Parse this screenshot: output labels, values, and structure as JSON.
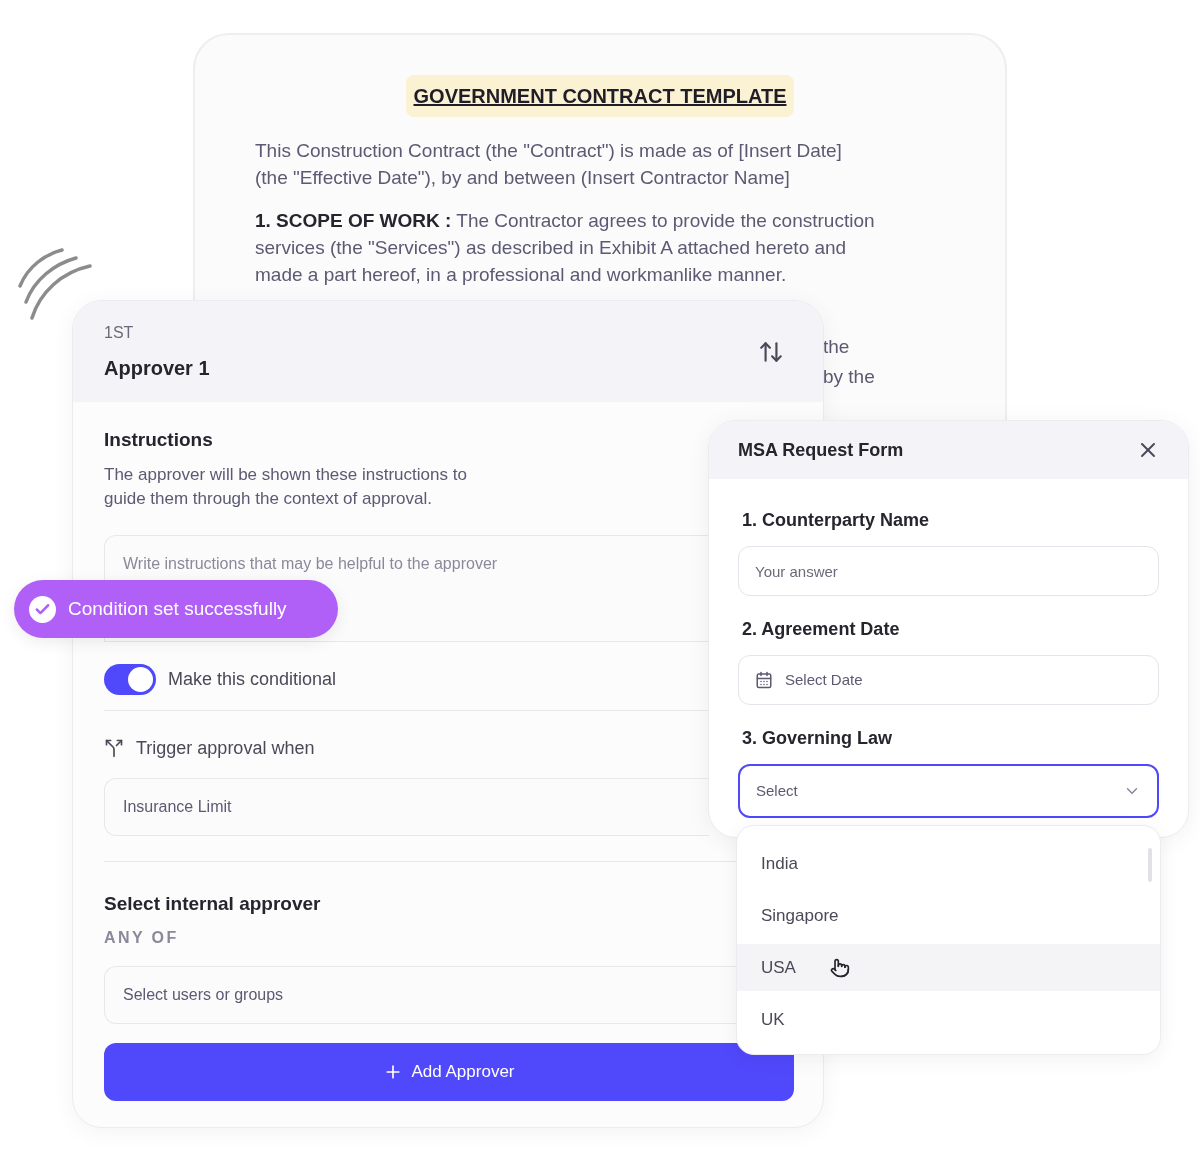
{
  "document": {
    "title": "GOVERNMENT CONTRACT TEMPLATE",
    "paragraphs": [
      {
        "lines": [
          "This Construction Contract (the \"Contract\") is made as of [Insert Date]",
          "(the \"Effective Date\"), by and between (Insert Contractor Name]"
        ]
      },
      {
        "lines": [
          "**1. SCOPE OF WORK :** The Contractor agrees to provide the construction",
          "services (the \"Services\") as described in Exhibit A attached hereto and",
          "made a part hereof, in a professional and workmanlike manner."
        ]
      }
    ],
    "visible_fragments": [
      "the",
      "by the"
    ]
  },
  "approver_card": {
    "order": "1ST",
    "title": "Approver 1",
    "instructions": {
      "heading": "Instructions",
      "description": "The approver will be shown these instructions to guide them through the context of approval.",
      "placeholder": "Write instructions that may be helpful to the approver"
    },
    "conditional": {
      "label": "Make this conditional",
      "on": true
    },
    "trigger": {
      "label": "Trigger approval when",
      "value": "Insurance Limit"
    },
    "approver_select": {
      "heading": "Select internal approver",
      "mode": "ANY OF",
      "placeholder": "Select users or groups"
    },
    "add_button": "Add Approver"
  },
  "toast": {
    "message": "Condition set successfully"
  },
  "msa_form": {
    "title": "MSA Request Form",
    "questions": [
      {
        "kind": "text",
        "label": "1. Counterparty Name",
        "placeholder": "Your answer"
      },
      {
        "kind": "date",
        "label": "2. Agreement Date",
        "placeholder": "Select Date"
      },
      {
        "kind": "select",
        "label": "3. Governing Law",
        "placeholder": "Select",
        "focused": true
      }
    ]
  },
  "dropdown": {
    "options": [
      {
        "label": "India",
        "hovered": false
      },
      {
        "label": "Singapore",
        "hovered": false
      },
      {
        "label": "USA",
        "hovered": true
      },
      {
        "label": "UK",
        "hovered": false
      }
    ]
  }
}
